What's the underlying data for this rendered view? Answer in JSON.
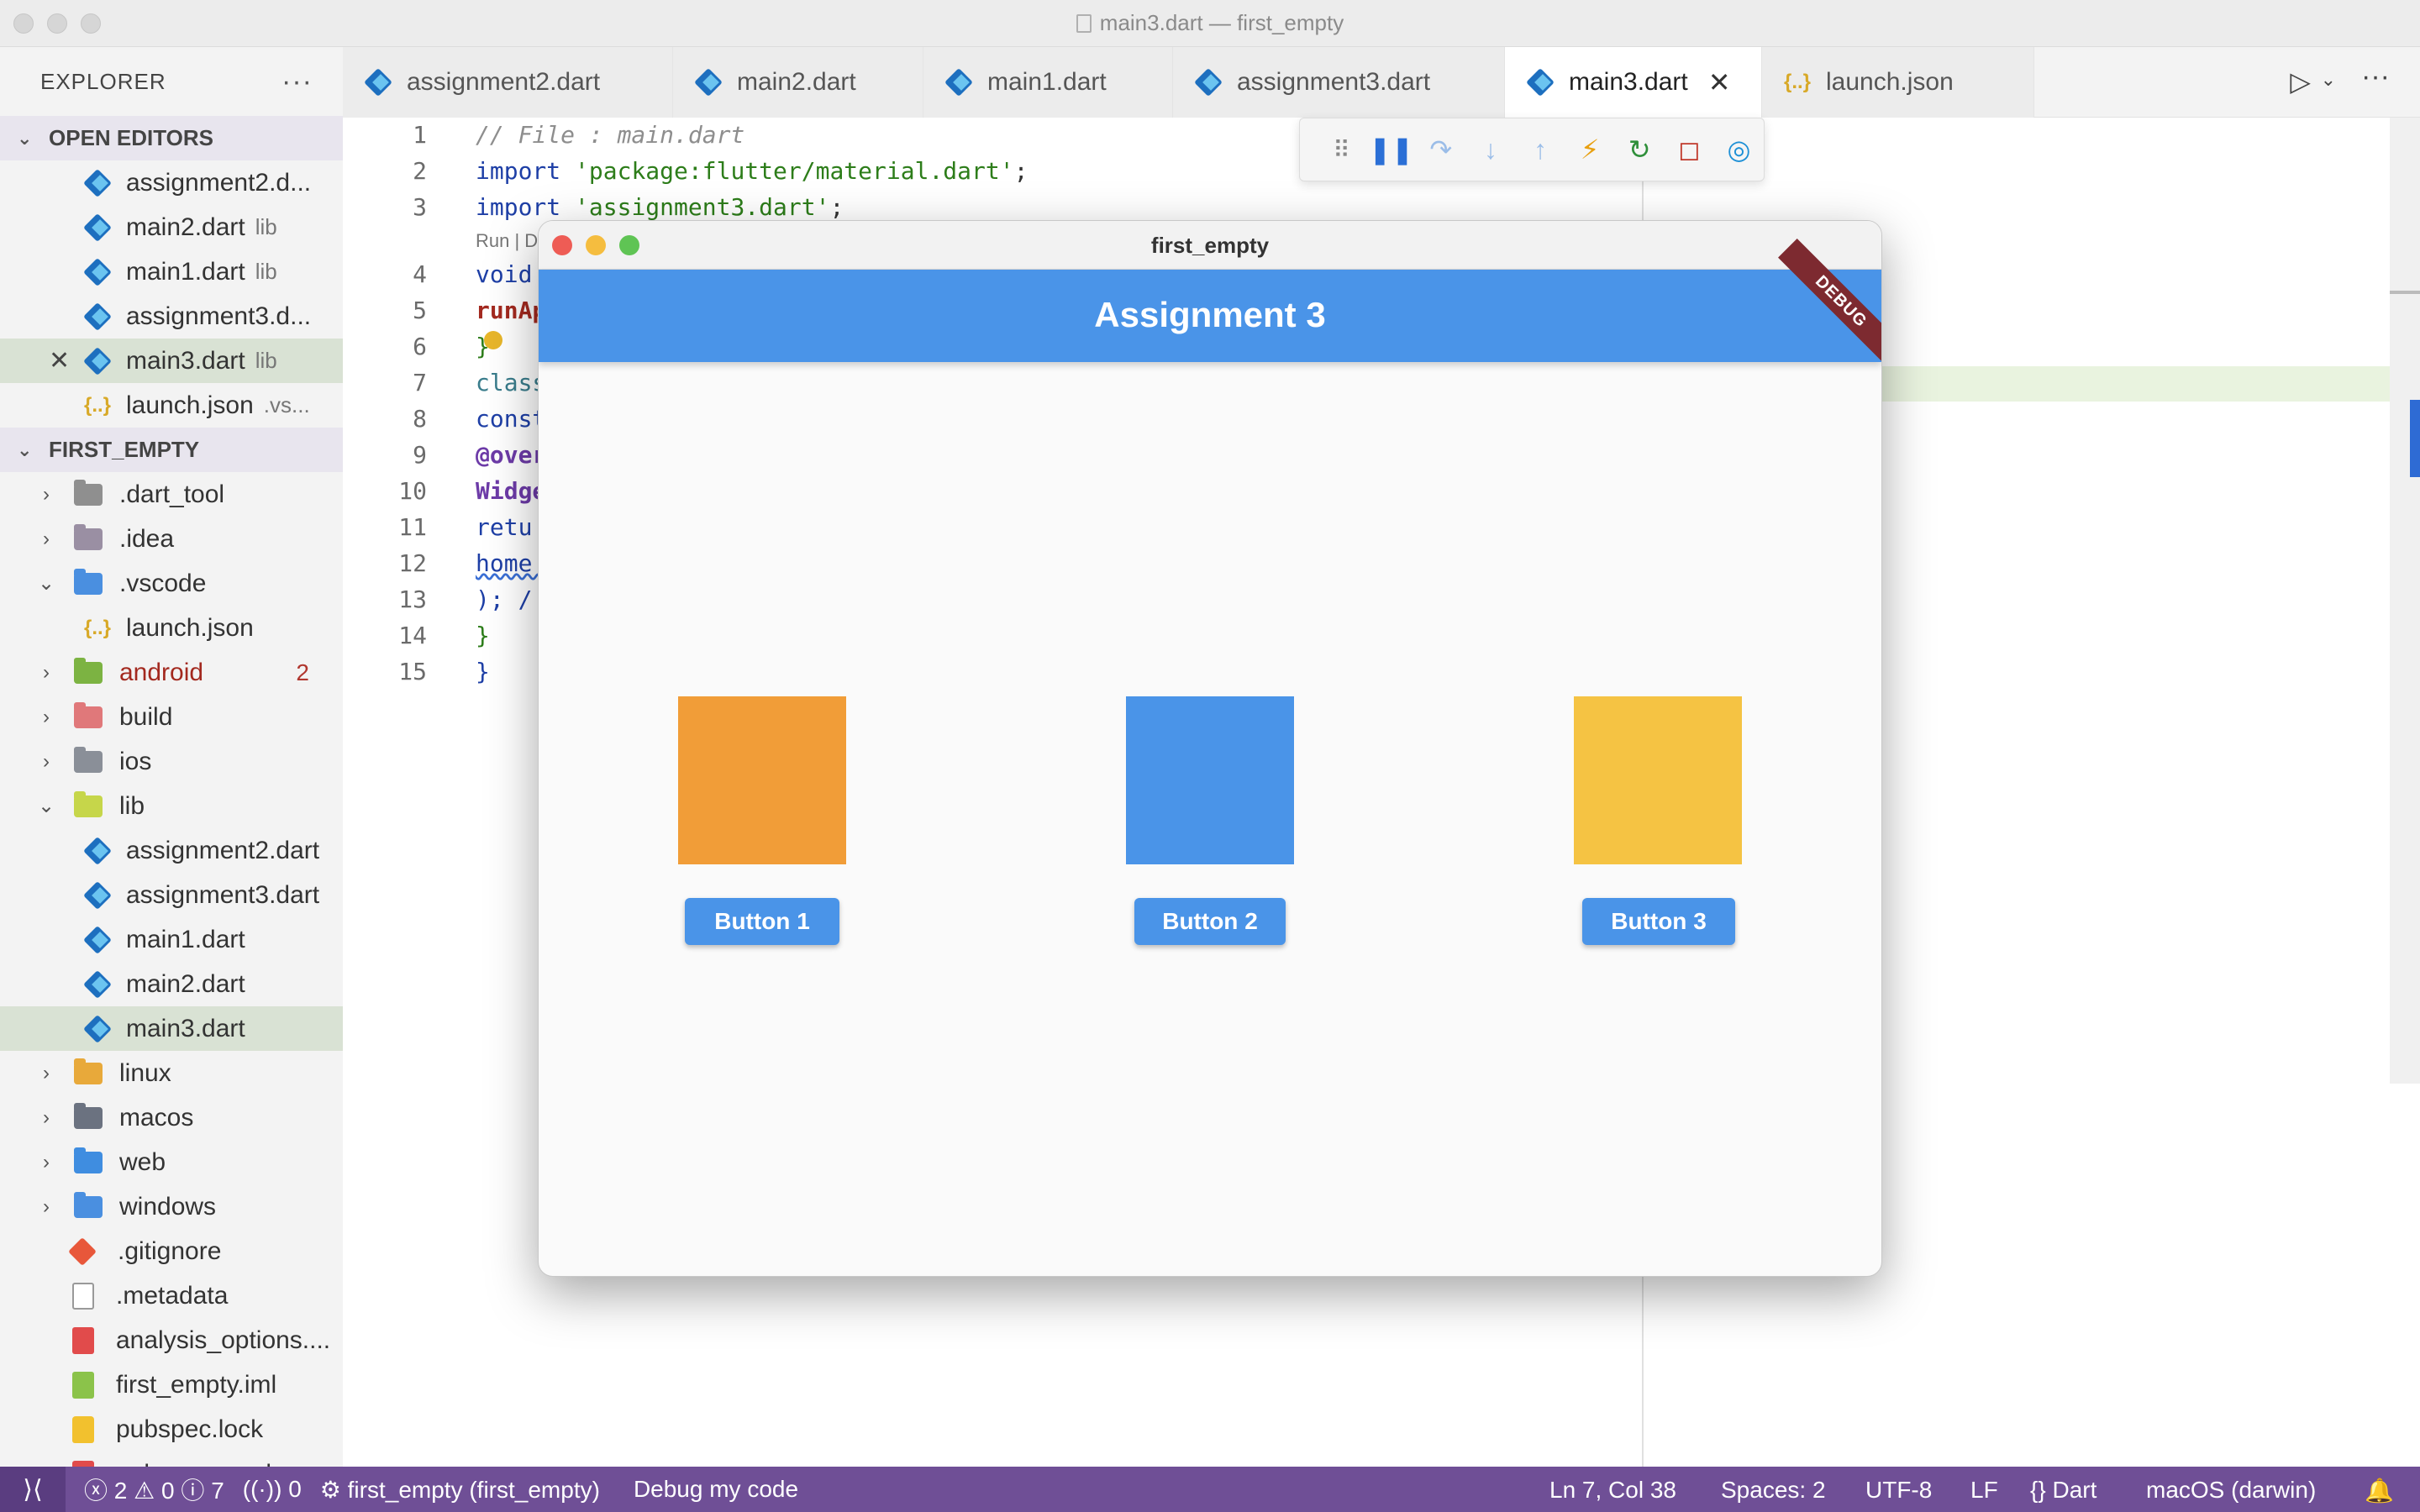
{
  "window": {
    "title": "main3.dart — first_empty"
  },
  "sidebar": {
    "header": "EXPLORER",
    "more": "···",
    "open_editors_title": "OPEN EDITORS",
    "open_editors": [
      {
        "name": "assignment2.d...",
        "desc": ""
      },
      {
        "name": "main2.dart",
        "desc": "lib"
      },
      {
        "name": "main1.dart",
        "desc": "lib"
      },
      {
        "name": "assignment3.d...",
        "desc": ""
      },
      {
        "name": "main3.dart",
        "desc": "lib"
      },
      {
        "name": "launch.json",
        "desc": ".vs..."
      }
    ],
    "workspace_title": "FIRST_EMPTY",
    "tree": [
      {
        "name": ".dart_tool"
      },
      {
        "name": ".idea"
      },
      {
        "name": ".vscode"
      },
      {
        "name": "launch.json"
      },
      {
        "name": "android",
        "badge": "2"
      },
      {
        "name": "build"
      },
      {
        "name": "ios"
      },
      {
        "name": "lib"
      },
      {
        "name": "assignment2.dart"
      },
      {
        "name": "assignment3.dart"
      },
      {
        "name": "main1.dart"
      },
      {
        "name": "main2.dart"
      },
      {
        "name": "main3.dart"
      },
      {
        "name": "linux"
      },
      {
        "name": "macos"
      },
      {
        "name": "web"
      },
      {
        "name": "windows"
      },
      {
        "name": ".gitignore"
      },
      {
        "name": ".metadata"
      },
      {
        "name": "analysis_options...."
      },
      {
        "name": "first_empty.iml"
      },
      {
        "name": "pubspec.lock"
      },
      {
        "name": "pubspec.yaml"
      }
    ]
  },
  "tabs": [
    {
      "label": "assignment2.dart"
    },
    {
      "label": "main2.dart"
    },
    {
      "label": "main1.dart"
    },
    {
      "label": "assignment3.dart"
    },
    {
      "label": "main3.dart"
    },
    {
      "label": "launch.json"
    }
  ],
  "editor": {
    "line_numbers": [
      "1",
      "2",
      "3",
      "4",
      "5",
      "6",
      "7",
      "8",
      "9",
      "10",
      "11",
      "12",
      "13",
      "14",
      "15"
    ],
    "codelens": "Run | D",
    "lines": {
      "l1": "// File : main.dart",
      "l2_kw": "import",
      "l2_str": "'package:flutter/material.dart'",
      "l2_end": ";",
      "l3_kw": "import",
      "l3_str": "'assignment3.dart'",
      "l3_end": ";",
      "l4": "void",
      "l5": "runAp",
      "l6": "}",
      "l7": "class",
      "l8": "const",
      "l9": "@over",
      "l10": "Widge",
      "l11": "retu",
      "l12": "home:",
      "l13": "); /",
      "l14": "}",
      "l15": "}"
    }
  },
  "app": {
    "title": "first_empty",
    "appbar_title": "Assignment 3",
    "debug_banner": "DEBUG",
    "colors": {
      "square1": "#f19d38",
      "square2": "#4a94e8",
      "square3": "#f5c343",
      "appbar": "#4a94e8"
    },
    "buttons": [
      "Button 1",
      "Button 2",
      "Button 3"
    ]
  },
  "statusbar": {
    "errors": "2",
    "warnings": "0",
    "infos": "7",
    "ports": "0",
    "debug_target": "first_empty (first_empty)",
    "debug_mode": "Debug my code",
    "position": "Ln 7, Col 38",
    "spaces": "Spaces: 2",
    "encoding": "UTF-8",
    "eol": "LF",
    "language": "Dart",
    "device": "macOS (darwin)"
  }
}
